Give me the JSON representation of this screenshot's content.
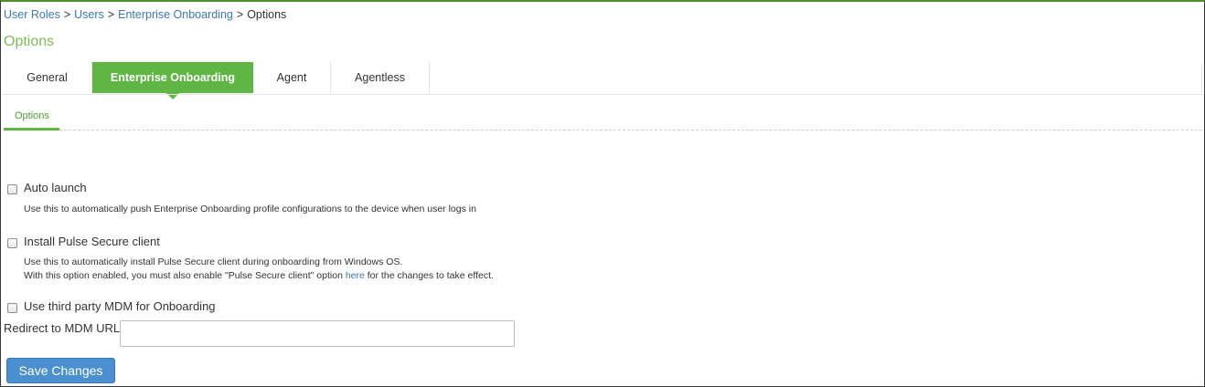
{
  "breadcrumb": {
    "items": [
      "User Roles",
      "Users",
      "Enterprise Onboarding"
    ],
    "separator": ">",
    "current": "Options"
  },
  "page": {
    "title": "Options"
  },
  "tabs": [
    {
      "label": "General",
      "active": false
    },
    {
      "label": "Enterprise Onboarding",
      "active": true
    },
    {
      "label": "Agent",
      "active": false
    },
    {
      "label": "Agentless",
      "active": false
    }
  ],
  "subtabs": [
    {
      "label": "Options",
      "active": true
    }
  ],
  "options": {
    "auto_launch": {
      "label": "Auto launch",
      "help": "Use this to automatically push Enterprise Onboarding profile configurations to the device when user logs in",
      "checked": false
    },
    "install_pulse": {
      "label": "Install Pulse Secure client",
      "help_line1": "Use this to automatically install Pulse Secure client during onboarding from Windows OS.",
      "help_line2_before": "With this option enabled, you must also enable \"Pulse Secure client\" option ",
      "help_line2_link": "here",
      "help_line2_after": " for the changes to take effect.",
      "checked": false
    },
    "third_party_mdm": {
      "label": "Use third party MDM for Onboarding",
      "checked": false
    }
  },
  "mdm_url": {
    "label": "Redirect to MDM URL",
    "value": "",
    "placeholder": ""
  },
  "actions": {
    "save_label": "Save Changes"
  },
  "colors": {
    "accent_green": "#5fb645",
    "title_green": "#7dbb52",
    "link_blue": "#3a78b5",
    "button_blue": "#4a8fcf"
  }
}
